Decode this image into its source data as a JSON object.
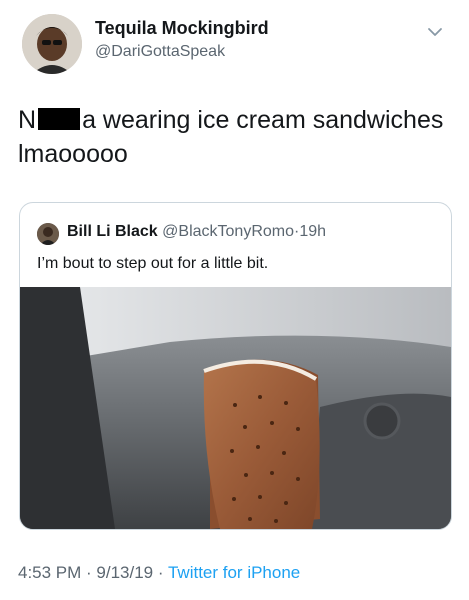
{
  "tweet": {
    "display_name": "Tequila Mockingbird",
    "handle": "@DariGottaSpeak",
    "text_part1": "N",
    "text_part2": "a wearing ice cream sandwiches lmaooooo",
    "timestamp": "4:53 PM",
    "date": "9/13/19",
    "source": "Twitter for iPhone",
    "separator": " · "
  },
  "quoted_tweet": {
    "display_name": "Bill Li Black",
    "handle": "@BlackTonyRomo",
    "age": "19h",
    "separator": "·",
    "text": "I’m bout to step out for a little bit."
  },
  "icons": {
    "menu": "chevron-down-icon"
  }
}
